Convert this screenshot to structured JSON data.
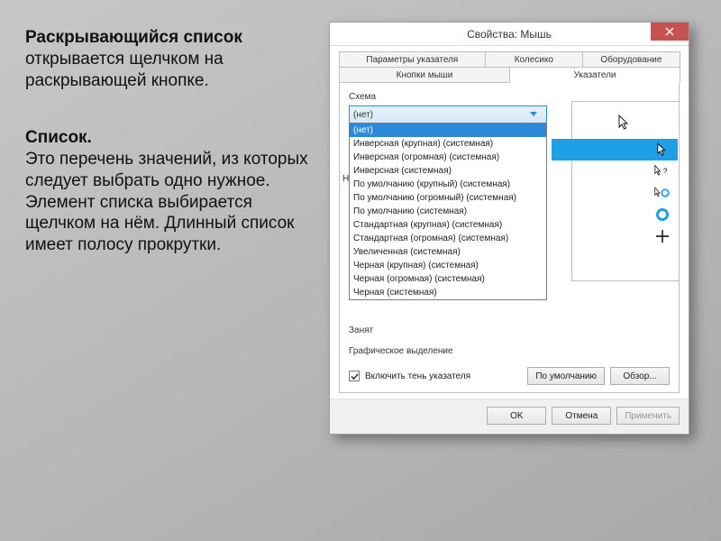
{
  "caption": {
    "heading1": "Раскрывающийся список",
    "text1": "открывается щелчком на раскрывающей кнопке.",
    "heading2": "Список.",
    "text2": "Это перечень значений, из которых следует выбрать одно нужное. Элемент списка выбирается щелчком на нём. Длинный список имеет полосу прокрутки."
  },
  "dialog": {
    "title": "Свойства: Мышь",
    "tabs_row1": [
      "Параметры указателя",
      "Колесико",
      "Оборудование"
    ],
    "tabs_row2": [
      "Кнопки мыши",
      "Указатели"
    ],
    "active_tab": "Указатели",
    "scheme_label": "Схема",
    "combo_value": "(нет)",
    "options": [
      "(нет)",
      "Инверсная (крупная) (системная)",
      "Инверсная (огромная) (системная)",
      "Инверсная (системная)",
      "По умолчанию (крупный) (системная)",
      "По умолчанию (огромный) (системная)",
      "По умолчанию (системная)",
      "Стандартная (крупная) (системная)",
      "Стандартная (огромная) (системная)",
      "Увеличенная (системная)",
      "Черная (крупная) (системная)",
      "Черная (огромная) (системная)",
      "Черная (системная)"
    ],
    "selected_option_index": 0,
    "behind_prefix": "Н",
    "busy_label": "Занят",
    "graphic_label": "Графическое выделение",
    "shadow_checkbox": "Включить тень указателя",
    "shadow_checked": true,
    "defaults_btn": "По умолчанию",
    "browse_btn": "Обзор...",
    "ok_btn": "OK",
    "cancel_btn": "Отмена",
    "apply_btn": "Применить"
  }
}
